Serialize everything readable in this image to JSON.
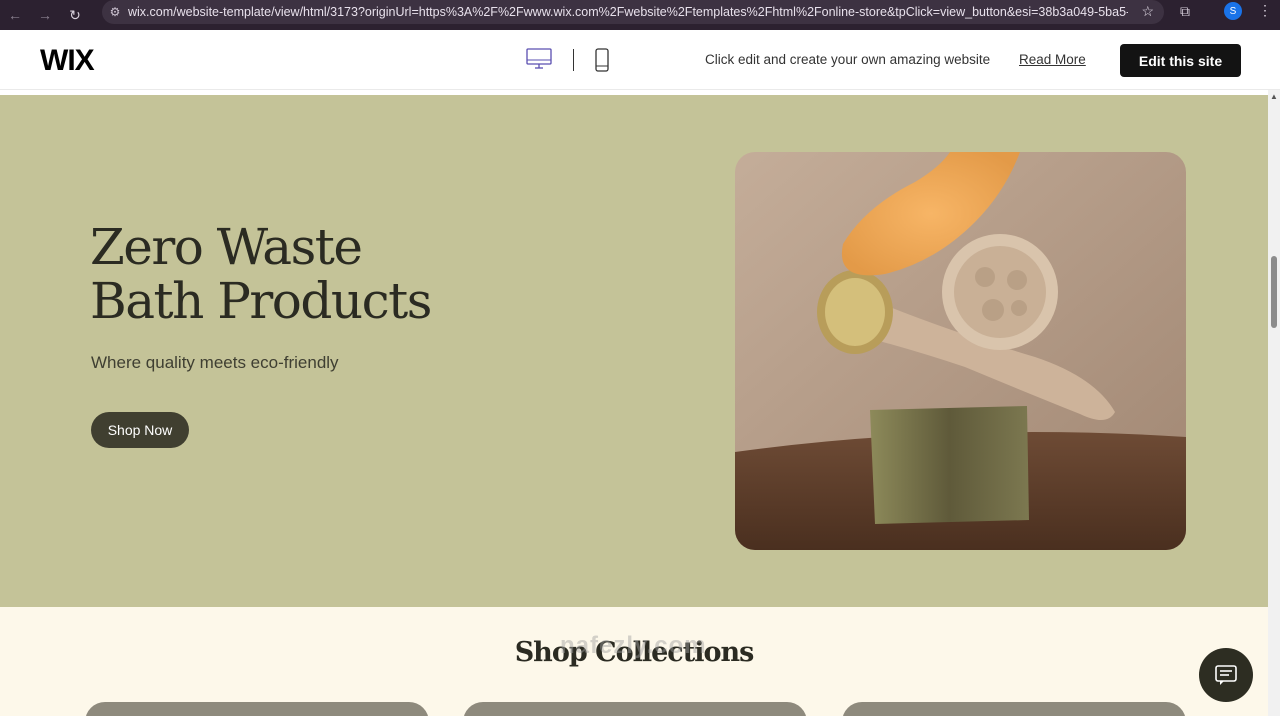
{
  "browser": {
    "url": "wix.com/website-template/view/html/3173?originUrl=https%3A%2F%2Fwww.wix.com%2Fwebsite%2Ftemplates%2Fhtml%2Fonline-store&tpClick=view_button&esi=38b3a049-5ba5-4238-92e...",
    "profile_initial": "S"
  },
  "wixbar": {
    "logo": "WIX",
    "message": "Click edit and create your own amazing website",
    "read_more": "Read More",
    "edit_button": "Edit this site"
  },
  "hero": {
    "title_line1": "Zero Waste",
    "title_line2": "Bath Products",
    "subtitle": "Where quality meets eco-friendly",
    "cta": "Shop Now"
  },
  "collections": {
    "title": "Shop Collections"
  },
  "watermark": "nafezly.com",
  "colors": {
    "hero_bg": "#c4c398",
    "collections_bg": "#fdf8ea",
    "button_dark": "#403f30",
    "edit_button_bg": "#131313"
  }
}
